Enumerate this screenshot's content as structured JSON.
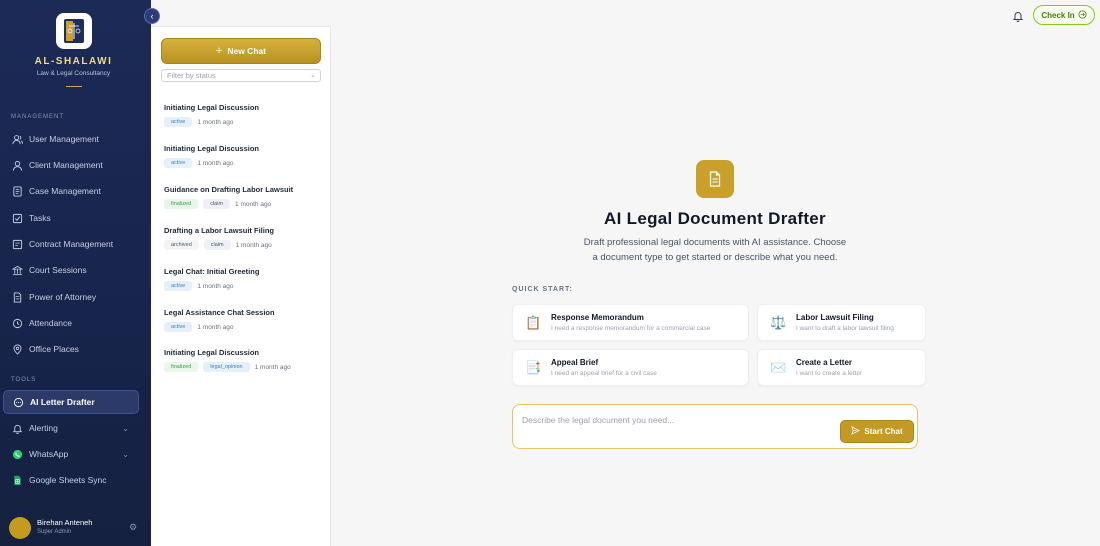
{
  "brand": {
    "name": "AL-SHALAWI",
    "subtitle": "Law & Legal Consultancy"
  },
  "sidebar": {
    "management_label": "MANAGEMENT",
    "management_items": [
      {
        "label": "User Management",
        "icon": "users-icon"
      },
      {
        "label": "Client Management",
        "icon": "user-icon"
      },
      {
        "label": "Case Management",
        "icon": "folder-icon"
      },
      {
        "label": "Tasks",
        "icon": "checkbox-icon"
      },
      {
        "label": "Contract Management",
        "icon": "contract-icon"
      },
      {
        "label": "Court Sessions",
        "icon": "court-icon"
      },
      {
        "label": "Power of Attorney",
        "icon": "document-icon"
      },
      {
        "label": "Attendance",
        "icon": "clock-icon"
      },
      {
        "label": "Office Places",
        "icon": "location-icon"
      }
    ],
    "tools_label": "TOOLS",
    "tools_items": [
      {
        "label": "AI Letter Drafter",
        "icon": "chat-icon",
        "active": true
      },
      {
        "label": "Alerting",
        "icon": "bell-icon"
      },
      {
        "label": "WhatsApp",
        "icon": "whatsapp-icon"
      },
      {
        "label": "Google Sheets Sync",
        "icon": "sheets-icon"
      }
    ],
    "user": {
      "name": "Birehan Anteneh",
      "role": "Super Admin"
    }
  },
  "chat_panel": {
    "new_chat_label": "New Chat",
    "filter_placeholder": "Filter by status",
    "chats": [
      {
        "title": "Initiating Legal Discussion",
        "badges": [
          "active"
        ],
        "time": "1 month ago"
      },
      {
        "title": "Initiating Legal Discussion",
        "badges": [
          "active"
        ],
        "time": "1 month ago"
      },
      {
        "title": "Guidance on Drafting Labor Lawsuit",
        "badges": [
          "finalized",
          "claim"
        ],
        "time": "1 month ago"
      },
      {
        "title": "Drafting a Labor Lawsuit Filing",
        "badges": [
          "archived",
          "claim"
        ],
        "time": "1 month ago"
      },
      {
        "title": "Legal Chat: Initial Greeting",
        "badges": [
          "active"
        ],
        "time": "1 month ago"
      },
      {
        "title": "Legal Assistance Chat Session",
        "badges": [
          "active"
        ],
        "time": "1 month ago"
      },
      {
        "title": "Initiating Legal Discussion",
        "badges": [
          "finalized",
          "legal_opinion"
        ],
        "time": "1 month ago"
      }
    ]
  },
  "topbar": {
    "checkin_label": "Check In"
  },
  "main": {
    "title": "AI Legal Document Drafter",
    "description": "Draft professional legal documents with AI assistance. Choose a document type to get started or describe what you need.",
    "quick_start_label": "QUICK START:",
    "quick_cards": [
      {
        "title": "Response Memorandum",
        "subtitle": "I need a response memorandum for a commercial case",
        "icon": "📋"
      },
      {
        "title": "Labor Lawsuit Filing",
        "subtitle": "I want to draft a labor lawsuit filing",
        "icon": "⚖️"
      },
      {
        "title": "Appeal Brief",
        "subtitle": "I need an appeal brief for a civil case",
        "icon": "📑"
      },
      {
        "title": "Create a Letter",
        "subtitle": "I want to create a letter",
        "icon": "✉️"
      }
    ],
    "compose_placeholder": "Describe the legal document you need...",
    "start_chat_label": "Start Chat"
  },
  "colors": {
    "sidebar_bg": "#1c2a57",
    "accent_gold": "#c49a24",
    "checkin_green": "#84cc16"
  }
}
